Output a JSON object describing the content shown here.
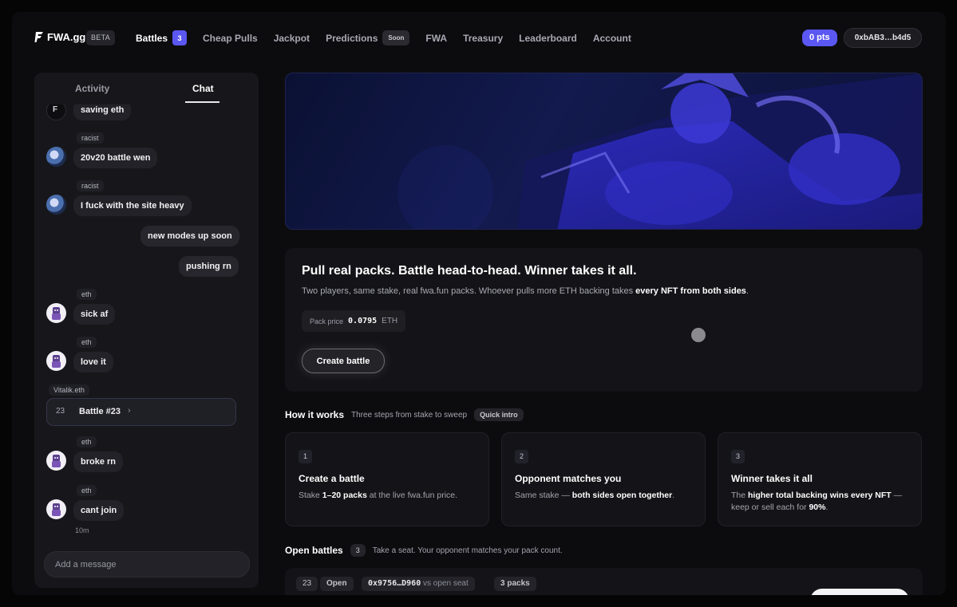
{
  "nav": {
    "brand": "FWA.gg",
    "beta": "BETA",
    "items": [
      {
        "label": "Battles",
        "badge": "3",
        "active": true
      },
      {
        "label": "Cheap Pulls"
      },
      {
        "label": "Jackpot"
      },
      {
        "label": "Predictions",
        "tag": "Soon"
      },
      {
        "label": "FWA"
      },
      {
        "label": "Treasury"
      },
      {
        "label": "Leaderboard"
      },
      {
        "label": "Account"
      }
    ],
    "points": "0 pts",
    "wallet": "0xbAB3…b4d5"
  },
  "sidebar": {
    "tabs": [
      "Activity",
      "Chat"
    ],
    "active_tab": "Chat",
    "messages": [
      {
        "text": "saving eth"
      },
      {
        "user": "racist",
        "text": "20v20 battle wen"
      },
      {
        "user": "racist",
        "text": "I fuck with the site heavy"
      },
      {
        "text": "new modes up soon"
      },
      {
        "text": "pushing rn"
      },
      {
        "user": "eth",
        "text": "sick af"
      },
      {
        "user": "eth",
        "text": "love it"
      },
      {
        "user": "Vitalik.eth",
        "battle_num": "23",
        "battle_label": "Battle #23"
      },
      {
        "user": "eth",
        "text": "broke rn"
      },
      {
        "user": "eth",
        "text": "cant join"
      }
    ],
    "last_time": "10m",
    "input_placeholder": "Add a message"
  },
  "promo": {
    "title": "Pull real packs. Battle head-to-head. Winner takes it all.",
    "subtitle_pre": "Two players, same stake, real fwa.fun packs. Whoever pulls more ETH backing takes ",
    "subtitle_bold": "every NFT from both sides",
    "subtitle_post": ".",
    "pack_price_label": "Pack price",
    "pack_price_value": "0.0795",
    "pack_price_unit": "ETH",
    "cta": "Create battle"
  },
  "how": {
    "heading": "How it works",
    "sub": "Three steps from stake to sweep",
    "pill": "Quick intro",
    "steps": [
      {
        "num": "1",
        "title": "Create a battle",
        "d1": "Stake ",
        "b1": "1–20 packs",
        "d2": " at the live fwa.fun price.",
        "b2": "",
        "d3": ""
      },
      {
        "num": "2",
        "title": "Opponent matches you",
        "d1": "Same stake — ",
        "b1": "both sides open together",
        "d2": ".",
        "b2": "",
        "d3": ""
      },
      {
        "num": "3",
        "title": "Winner takes it all",
        "d1": "The ",
        "b1": "higher total backing wins every NFT",
        "d2": " — keep or sell each for ",
        "b2": "90%",
        "d3": "."
      }
    ]
  },
  "open_battles": {
    "heading": "Open battles",
    "count": "3",
    "sub": "Take a seat. Your opponent matches your pack count.",
    "row": {
      "num": "23",
      "status": "Open",
      "address": "0x9756…D960",
      "vs": "vs",
      "seat": "open seat",
      "packs": "3 packs"
    }
  }
}
